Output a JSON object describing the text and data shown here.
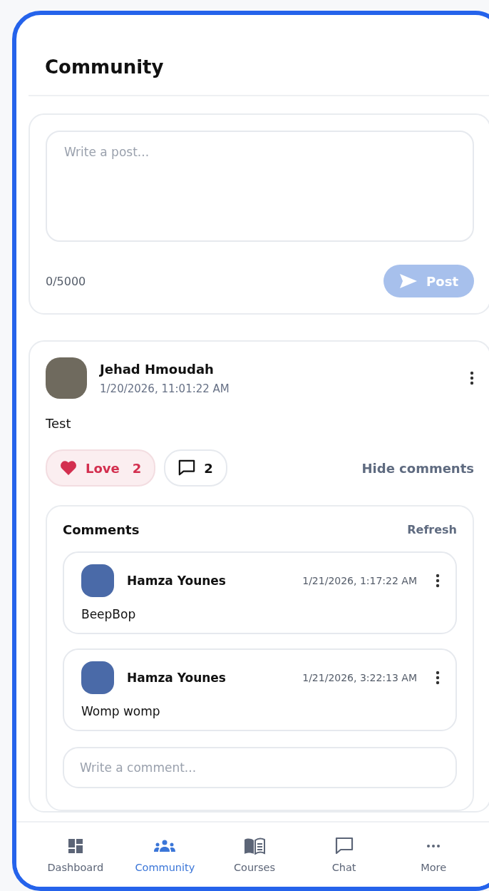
{
  "header": {
    "title": "Community"
  },
  "composer": {
    "placeholder": "Write a post...",
    "counter": "0/5000",
    "post_button": {
      "label": "Post",
      "disabled": true
    }
  },
  "posts": [
    {
      "author": "Jehad Hmoudah",
      "time": "1/20/2026, 11:01:22 AM",
      "body": "Test",
      "love": {
        "label": "Love",
        "count": "2",
        "selected": true
      },
      "comment_count": "2",
      "toggle_label": "Hide comments",
      "comments": {
        "title": "Comments",
        "refresh": "Refresh",
        "placeholder": "Write a comment...",
        "items": [
          {
            "author": "Hamza Younes",
            "time": "1/21/2026, 1:17:22 AM",
            "body": "BeepBop"
          },
          {
            "author": "Hamza Younes",
            "time": "1/21/2026, 3:22:13 AM",
            "body": "Womp womp"
          }
        ]
      }
    }
  ],
  "nav": [
    {
      "label": "Dashboard",
      "kind": "dashboard",
      "selected": false
    },
    {
      "label": "Community",
      "kind": "people",
      "selected": true
    },
    {
      "label": "Courses",
      "kind": "book",
      "selected": false
    },
    {
      "label": "Chat",
      "kind": "chat",
      "selected": false
    },
    {
      "label": "More",
      "kind": "more",
      "selected": false
    }
  ]
}
